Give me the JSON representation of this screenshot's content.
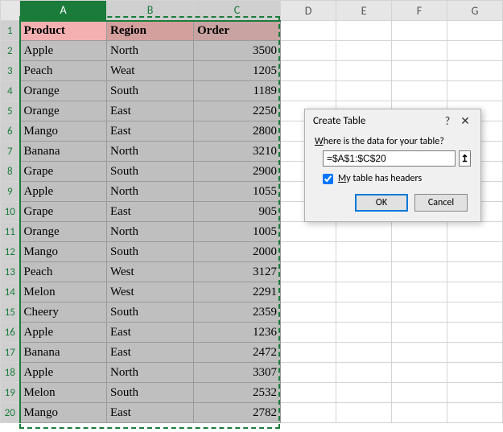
{
  "columns": [
    "A",
    "B",
    "C",
    "D",
    "E",
    "F",
    "G"
  ],
  "selected_cols": [
    "A",
    "B",
    "C"
  ],
  "first_selected_col": "A",
  "rows_shown": 20,
  "headers": {
    "A": "Product",
    "B": "Region",
    "C": "Order"
  },
  "data": [
    {
      "A": "Apple",
      "B": "North",
      "C": 3500
    },
    {
      "A": "Peach",
      "B": "Weat",
      "C": 1205
    },
    {
      "A": "Orange",
      "B": "South",
      "C": 1189
    },
    {
      "A": "Orange",
      "B": "East",
      "C": 2250
    },
    {
      "A": "Mango",
      "B": "East",
      "C": 2800
    },
    {
      "A": "Banana",
      "B": "North",
      "C": 3210
    },
    {
      "A": "Grape",
      "B": "South",
      "C": 2900
    },
    {
      "A": "Apple",
      "B": "North",
      "C": 1055
    },
    {
      "A": "Grape",
      "B": "East",
      "C": 905
    },
    {
      "A": "Orange",
      "B": "North",
      "C": 1005
    },
    {
      "A": "Mango",
      "B": "South",
      "C": 2000
    },
    {
      "A": "Peach",
      "B": "West",
      "C": 3127
    },
    {
      "A": "Melon",
      "B": "West",
      "C": 2291
    },
    {
      "A": "Cheery",
      "B": "South",
      "C": 2359
    },
    {
      "A": "Apple",
      "B": "East",
      "C": 1236
    },
    {
      "A": "Banana",
      "B": "East",
      "C": 2472
    },
    {
      "A": "Apple",
      "B": "North",
      "C": 3307
    },
    {
      "A": "Melon",
      "B": "South",
      "C": 2532
    },
    {
      "A": "Mango",
      "B": "East",
      "C": 2782
    }
  ],
  "dialog": {
    "title": "Create Table",
    "help_char": "?",
    "close_char": "✕",
    "prompt_pre": "W",
    "prompt_rest": "here is the data for your table?",
    "range_value": "=$A$1:$C$20",
    "checkbox_checked": true,
    "checkbox_pre": "M",
    "checkbox_rest": "y table has headers",
    "ok": "OK",
    "cancel": "Cancel",
    "refedit_glyph": "↥"
  },
  "chart_data": {
    "type": "table",
    "title": "",
    "columns": [
      "Product",
      "Region",
      "Order"
    ],
    "rows": [
      [
        "Apple",
        "North",
        3500
      ],
      [
        "Peach",
        "Weat",
        1205
      ],
      [
        "Orange",
        "South",
        1189
      ],
      [
        "Orange",
        "East",
        2250
      ],
      [
        "Mango",
        "East",
        2800
      ],
      [
        "Banana",
        "North",
        3210
      ],
      [
        "Grape",
        "South",
        2900
      ],
      [
        "Apple",
        "North",
        1055
      ],
      [
        "Grape",
        "East",
        905
      ],
      [
        "Orange",
        "North",
        1005
      ],
      [
        "Mango",
        "South",
        2000
      ],
      [
        "Peach",
        "West",
        3127
      ],
      [
        "Melon",
        "West",
        2291
      ],
      [
        "Cheery",
        "South",
        2359
      ],
      [
        "Apple",
        "East",
        1236
      ],
      [
        "Banana",
        "East",
        2472
      ],
      [
        "Apple",
        "North",
        3307
      ],
      [
        "Melon",
        "South",
        2532
      ],
      [
        "Mango",
        "East",
        2782
      ]
    ]
  }
}
